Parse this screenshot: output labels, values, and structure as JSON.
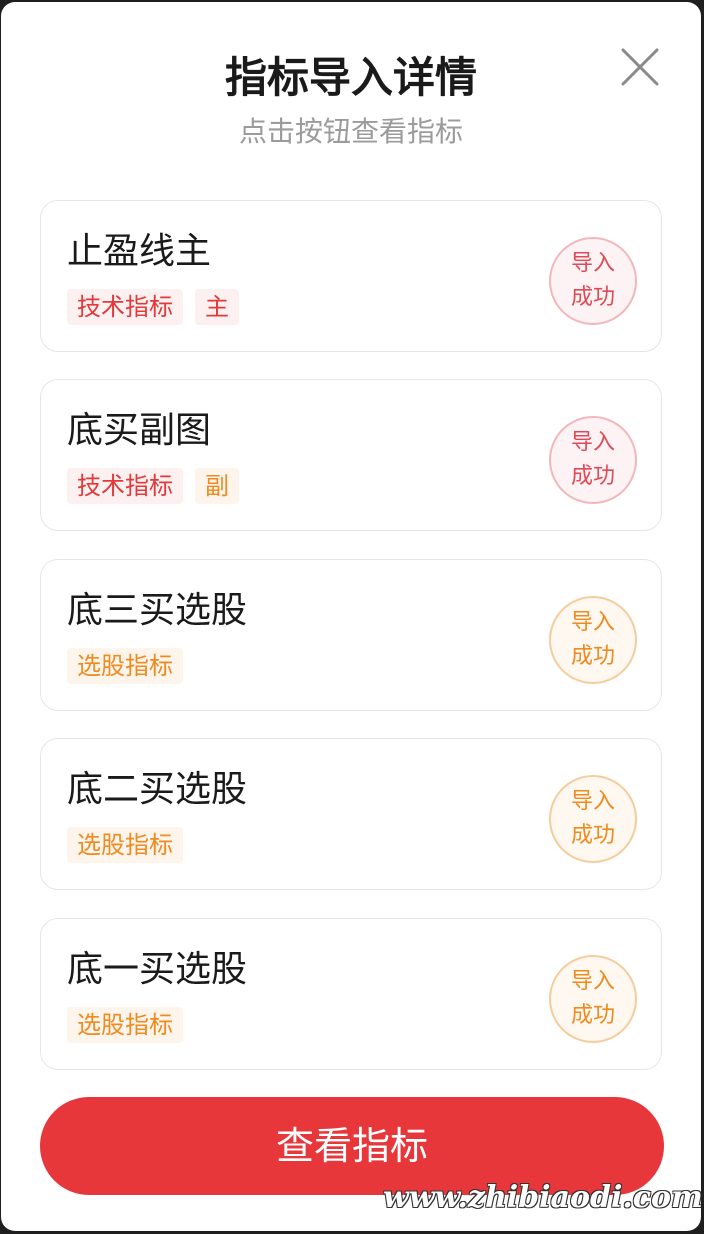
{
  "dialog": {
    "title": "指标导入详情",
    "subtitle": "点击按钮查看指标",
    "close_icon": "close-icon"
  },
  "indicators": [
    {
      "name": "止盈线主",
      "tags": [
        {
          "label": "技术指标",
          "color": "red"
        },
        {
          "label": "主",
          "color": "red"
        }
      ],
      "status_line1": "导入",
      "status_line2": "成功",
      "status_color": "red"
    },
    {
      "name": "底买副图",
      "tags": [
        {
          "label": "技术指标",
          "color": "red"
        },
        {
          "label": "副",
          "color": "orange"
        }
      ],
      "status_line1": "导入",
      "status_line2": "成功",
      "status_color": "red"
    },
    {
      "name": "底三买选股",
      "tags": [
        {
          "label": "选股指标",
          "color": "orange"
        }
      ],
      "status_line1": "导入",
      "status_line2": "成功",
      "status_color": "orange"
    },
    {
      "name": "底二买选股",
      "tags": [
        {
          "label": "选股指标",
          "color": "orange"
        }
      ],
      "status_line1": "导入",
      "status_line2": "成功",
      "status_color": "orange"
    },
    {
      "name": "底一买选股",
      "tags": [
        {
          "label": "选股指标",
          "color": "orange"
        }
      ],
      "status_line1": "导入",
      "status_line2": "成功",
      "status_color": "orange"
    }
  ],
  "action": {
    "view_label": "查看指标"
  },
  "watermark": "www.zhibiaodi.com",
  "colors": {
    "primary_red": "#e8373a",
    "tag_red": "#e23a3a",
    "tag_orange": "#ef8a1f"
  }
}
